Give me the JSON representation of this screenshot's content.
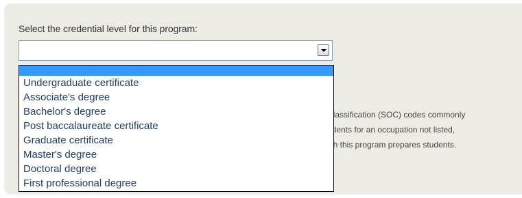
{
  "form": {
    "prompt": "Select the credential level for this program:",
    "selected_value": ""
  },
  "background_text": {
    "line1": "Classification (SOC) codes commonly",
    "line2": "udents for an occupation not listed,",
    "line3": "ich this program prepares students."
  },
  "dropdown": {
    "options": [
      "Undergraduate certificate",
      "Associate's degree",
      "Bachelor's degree",
      "Post baccalaureate certificate",
      "Graduate certificate",
      "Master's degree",
      "Doctoral degree",
      "First professional degree"
    ]
  },
  "colors": {
    "panel_bg": "#ecece4",
    "highlight": "#3399ff",
    "option_text": "#1f3d6b"
  }
}
